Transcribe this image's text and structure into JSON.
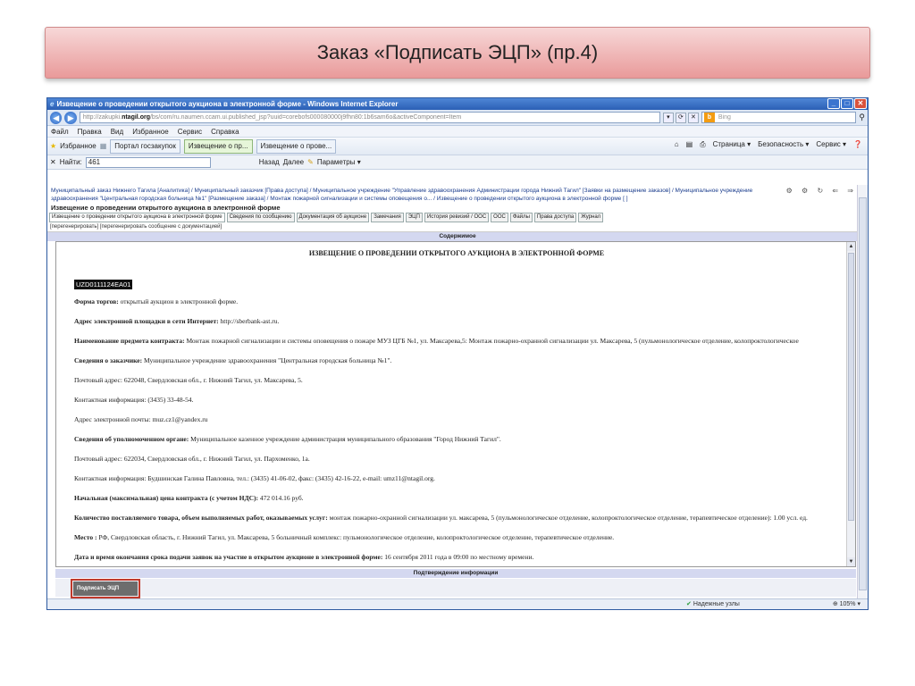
{
  "slide": {
    "title": "Заказ «Подписать ЭЦП» (пр.4)"
  },
  "window": {
    "title": "Извещение о проведении открытого аукциона в электронной форме - Windows Internet Explorer",
    "url_prefix": "http://zakupki.",
    "url_domain": "ntagil.org",
    "url_rest": "/bs/com/ru.naumen.ccam.ui.published_jsp?uuid=corebofs000080000j9fhn80:1b6sam6o&activeComponent=Item",
    "search_placeholder": "Bing"
  },
  "menu": [
    "Файл",
    "Правка",
    "Вид",
    "Избранное",
    "Сервис",
    "Справка"
  ],
  "favorites": {
    "label": "Избранное",
    "tabs": [
      "Портал госзакупок",
      "Извещение о пр...",
      "Извещение о прове..."
    ],
    "right": [
      "Страница ▾",
      "Безопасность ▾",
      "Сервис ▾"
    ]
  },
  "find": {
    "label": "Найти:",
    "value": "461",
    "back": "Назад",
    "next": "Далее",
    "params": "Параметры ▾"
  },
  "breadcrumb": "Муниципальный заказ Нижнего Тагила [Аналитика] / Муниципальный заказчик [Права доступа] / Муниципальное учреждение \"Управление здравоохранения Администрации города Нижний Тагил\" [Заявки на размещение заказов] / Муниципальное учреждение здравоохранения \"Центральная городская больница №1\" [Размещение заказа] / Монтаж пожарной сигнализации и системы оповещения о... / Извещение о проведении открытого аукциона в электронной форме [ ]",
  "heading": "Извещение о проведении открытого аукциона в электронной форме",
  "tabs": [
    "Извещение о проведении открытого аукциона в электронной форме",
    "Сведения по сообщению",
    "Документация об аукционе",
    "Замечания",
    "ЭЦП",
    "История ревизий / ООС",
    "ООС",
    "Файлы",
    "Права доступа",
    "Журнал"
  ],
  "links": "[перегенерировать] [перегенерировать сообщение с документацией]",
  "sections": {
    "content": "Содержимое",
    "confirm": "Подтверждение информации"
  },
  "document": {
    "title": "ИЗВЕЩЕНИЕ О ПРОВЕДЕНИИ ОТКРЫТОГО АУКЦИОНА В ЭЛЕКТРОННОЙ ФОРМЕ",
    "id": "UZD0111124EA01",
    "lines": [
      {
        "label": "Форма торгов:",
        "text": " открытый аукцион в электронной форме."
      },
      {
        "label": "Адрес электронной площадки в сети Интернет:",
        "text": " http://sberbank-ast.ru."
      },
      {
        "label": "Наименование предмета контракта:",
        "text": " Монтаж пожарной сигнализации и системы оповещения о пожаре МУЗ ЦГБ №1, ул. Максарева,5: Монтаж пожарно-охранной сигнализации ул. Максарева, 5 (пульмонологическое отделение, колопроктологическое"
      },
      {
        "label": "Сведения о заказчике:",
        "text": " Муниципальное учреждение здравоохранения \"Центральная городская больница №1\"."
      },
      {
        "label": "",
        "text": "Почтовый адрес: 622048, Свердловская обл., г. Нижний Тагил, ул. Максарева, 5."
      },
      {
        "label": "",
        "text": "Контактная информация: (3435) 33-48-54."
      },
      {
        "label": "",
        "text": "Адрес электронной почты: muz.cz1@yandex.ru"
      },
      {
        "label": "Сведения об уполномоченном органе:",
        "text": " Муниципальное казенное учреждение администрация муниципального образования \"Город Нижний Тагил\"."
      },
      {
        "label": "",
        "text": "Почтовый адрес: 622034, Свердловская обл., г. Нижний Тагил, ул. Пархоменко, 1а."
      },
      {
        "label": "",
        "text": "Контактная информация: Будшинская Галина Павловна, тел.: (3435) 41-06-02, факс: (3435) 42-16-22, e-mail: umz11@ntagil.org."
      },
      {
        "label": "Начальная (максимальная) цена контракта (с учетом НДС):",
        "text": " 472 014.16 руб."
      },
      {
        "label": "Количество поставляемого товара, объем выполняемых работ, оказываемых услуг:",
        "text": " монтаж пожарно-охранной сигнализации ул. максарева, 5 (пульмонологическое отделение, колопроктологическое отделение, терапевтическое отделение): 1.00 усл. ед."
      },
      {
        "label": "Место :",
        "text": " РФ, Свердловская область, г. Нижний Тагил, ул. Максарева, 5 больничный комплекс: пульмонологическое отделение, колопроктологическое отделение, терапевтическое отделение."
      },
      {
        "label": "Дата и время окончания срока подачи заявок на участие в открытом аукционе в электронной форме:",
        "text": " 16 сентября 2011 года в 09:00 по местному времени."
      }
    ]
  },
  "sign_button": "Подписать ЭЦП",
  "status": {
    "trusted": "Надежные узлы",
    "zoom": "105%"
  }
}
